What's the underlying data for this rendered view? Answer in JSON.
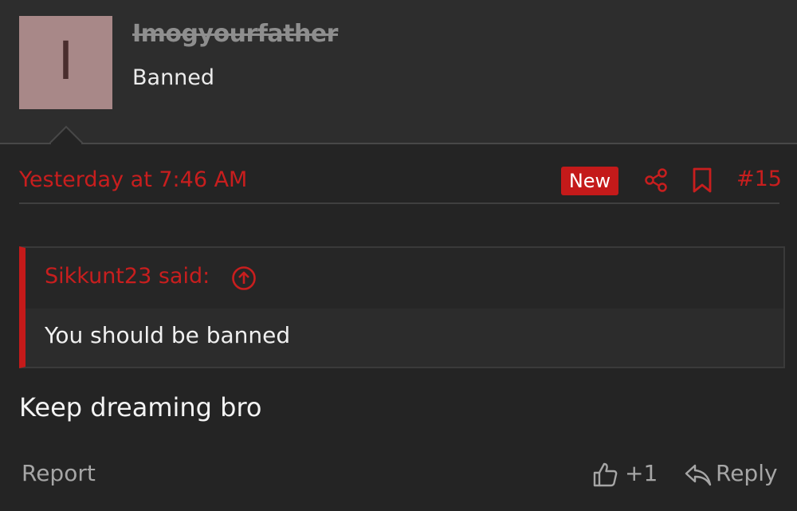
{
  "user": {
    "avatar_letter": "I",
    "username": "Imogyourfather",
    "title": "Banned"
  },
  "post": {
    "date": "Yesterday at 7:46 AM",
    "badge": "New",
    "number": "#15"
  },
  "quote": {
    "author": "Sikkunt23 said:",
    "text": "You should be banned"
  },
  "message": {
    "text": "Keep dreaming bro"
  },
  "actions": {
    "report": "Report",
    "like_count": "+1",
    "reply": "Reply"
  },
  "icons": {
    "share": "share-icon",
    "bookmark": "bookmark-icon",
    "quote_jump": "arrow-up-circle-icon",
    "like": "thumbs-up-icon",
    "reply": "reply-arrow-icon"
  },
  "colors": {
    "accent": "#c81e1e",
    "badge_bg": "#c41a1a",
    "background": "#242424",
    "header_bg": "#2d2d2d",
    "avatar_bg": "#a88888",
    "muted_text": "#a6a6a6"
  }
}
